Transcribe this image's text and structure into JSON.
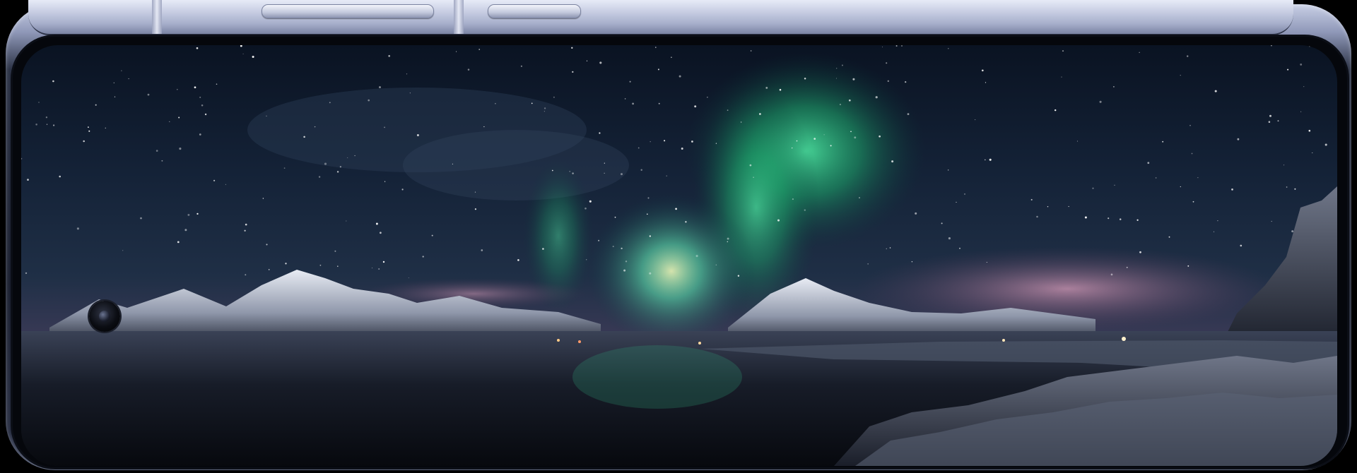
{
  "scene": {
    "subject": "smartphone-landscape",
    "wallpaper": "aurora-over-fjord",
    "colors": {
      "frame_light": "#c9d0e6",
      "frame_dark": "#1b2030",
      "sky_top": "#0a1322",
      "aurora_green": "#2fd38a",
      "horizon_pink": "#c98aa8",
      "water_dark": "#0d1119"
    }
  }
}
